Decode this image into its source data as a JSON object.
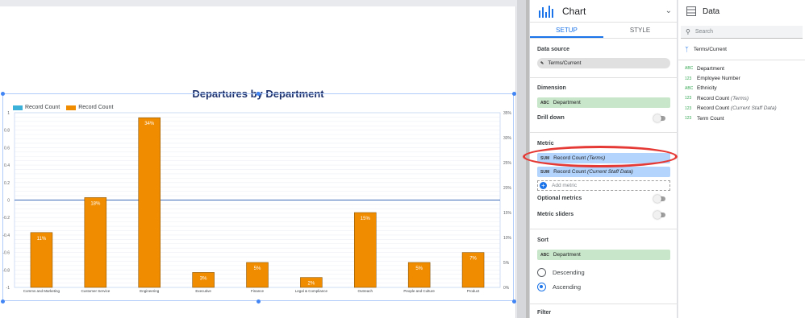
{
  "chart_data": {
    "type": "bar",
    "title": "Departures by Department",
    "categories": [
      "Comms and Marketing",
      "Customer Service",
      "Engineering",
      "Executive",
      "Finance",
      "Legal & Compliance",
      "Outreach",
      "People and Culture",
      "Product"
    ],
    "series": [
      {
        "name": "Record Count",
        "values": [
          0,
          0,
          0,
          0,
          0,
          0,
          0,
          0,
          0
        ],
        "color": "#3bb0d8"
      },
      {
        "name": "Record Count",
        "values": [
          11,
          18,
          34,
          3,
          5,
          2,
          15,
          5,
          7
        ],
        "color": "#f08c00",
        "labels": [
          "11%",
          "18%",
          "34%",
          "3%",
          "5%",
          "2%",
          "15%",
          "5%",
          "7%"
        ]
      }
    ],
    "left_axis": {
      "ticks": [
        "1",
        "0.8",
        "0.6",
        "0.4",
        "0.2",
        "0",
        "-0.2",
        "-0.4",
        "-0.6",
        "-0.8",
        "-1"
      ],
      "ylim": [
        -1,
        1
      ]
    },
    "right_axis": {
      "ticks": [
        "35%",
        "30%",
        "25%",
        "20%",
        "15%",
        "10%",
        "5%",
        "0%"
      ],
      "ylim": [
        0,
        35
      ]
    },
    "legend": "top-left",
    "grid": true
  },
  "properties": {
    "title": "Chart",
    "tabs": [
      {
        "label": "SETUP"
      },
      {
        "label": "STYLE"
      }
    ],
    "data_source_label": "Data source",
    "data_source": "Terms/Current",
    "dimension_label": "Dimension",
    "dimension": {
      "tag": "ABC",
      "name": "Department"
    },
    "drill_down": "Drill down",
    "metric_label": "Metric",
    "metrics": [
      {
        "tag": "SUM",
        "name": "Record Count",
        "sub": "(Terms)"
      },
      {
        "tag": "SUM",
        "name": "Record Count",
        "sub": "(Current Staff Data)"
      }
    ],
    "add_metric": "Add metric",
    "optional_metrics": "Optional metrics",
    "metric_sliders": "Metric sliders",
    "sort_label": "Sort",
    "sort": {
      "tag": "ABC",
      "name": "Department"
    },
    "descending": "Descending",
    "ascending": "Ascending",
    "filter_label": "Filter"
  },
  "data_panel": {
    "title": "Data",
    "search_placeholder": "Search",
    "source": "Terms/Current",
    "fields": [
      {
        "type": "ABC",
        "name": "Department",
        "sub": ""
      },
      {
        "type": "123",
        "name": "Employee Number",
        "sub": ""
      },
      {
        "type": "ABC",
        "name": "Ethnicity",
        "sub": ""
      },
      {
        "type": "123",
        "name": "Record Count",
        "sub": "(Terms)"
      },
      {
        "type": "123",
        "name": "Record Count",
        "sub": "(Current Staff Data)"
      },
      {
        "type": "123",
        "name": "Term Count",
        "sub": ""
      }
    ]
  }
}
